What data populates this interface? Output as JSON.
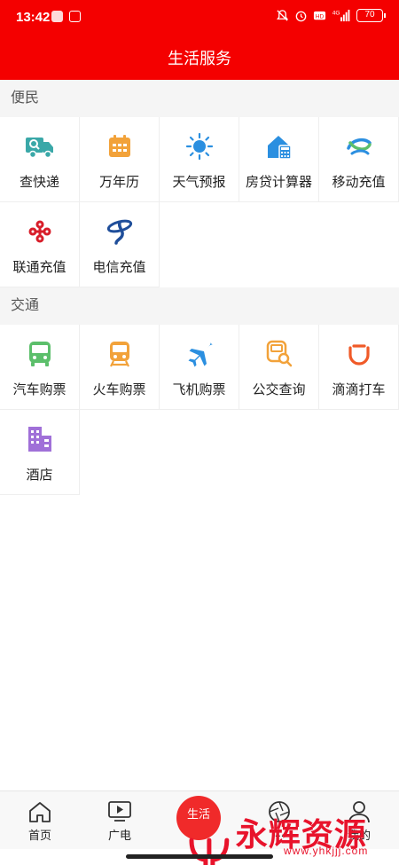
{
  "statusbar": {
    "time": "13:42",
    "battery": "70",
    "network": "4G"
  },
  "header": {
    "title": "生活服务"
  },
  "sections": [
    {
      "title": "便民",
      "items": [
        {
          "label": "查快递",
          "icon": "delivery-truck-icon"
        },
        {
          "label": "万年历",
          "icon": "calendar-icon"
        },
        {
          "label": "天气预报",
          "icon": "sun-icon"
        },
        {
          "label": "房贷计算器",
          "icon": "house-calculator-icon"
        },
        {
          "label": "移动充值",
          "icon": "china-mobile-icon"
        },
        {
          "label": "联通充值",
          "icon": "china-unicom-icon"
        },
        {
          "label": "电信充值",
          "icon": "china-telecom-icon"
        }
      ]
    },
    {
      "title": "交通",
      "items": [
        {
          "label": "汽车购票",
          "icon": "bus-icon"
        },
        {
          "label": "火车购票",
          "icon": "train-icon"
        },
        {
          "label": "飞机购票",
          "icon": "airplane-icon"
        },
        {
          "label": "公交查询",
          "icon": "bus-search-icon"
        },
        {
          "label": "滴滴打车",
          "icon": "didi-icon"
        },
        {
          "label": "酒店",
          "icon": "hotel-icon"
        }
      ]
    }
  ],
  "bottomnav": {
    "items": [
      {
        "label": "首页",
        "icon": "home-icon"
      },
      {
        "label": "广电",
        "icon": "video-play-icon"
      },
      {
        "label": "生活",
        "icon": "life-center-icon"
      },
      {
        "label": "...",
        "icon": "aperture-icon"
      },
      {
        "label": "我的",
        "icon": "person-icon"
      }
    ]
  },
  "watermark": {
    "text": "永辉资源网",
    "url": "www.yhkjjj.com"
  },
  "colors": {
    "brand": "#f40000",
    "teal": "#3aa8a8",
    "orange": "#f2a23a",
    "blue": "#2b8fe0",
    "green": "#5cbf6b",
    "purple": "#a070d8"
  }
}
